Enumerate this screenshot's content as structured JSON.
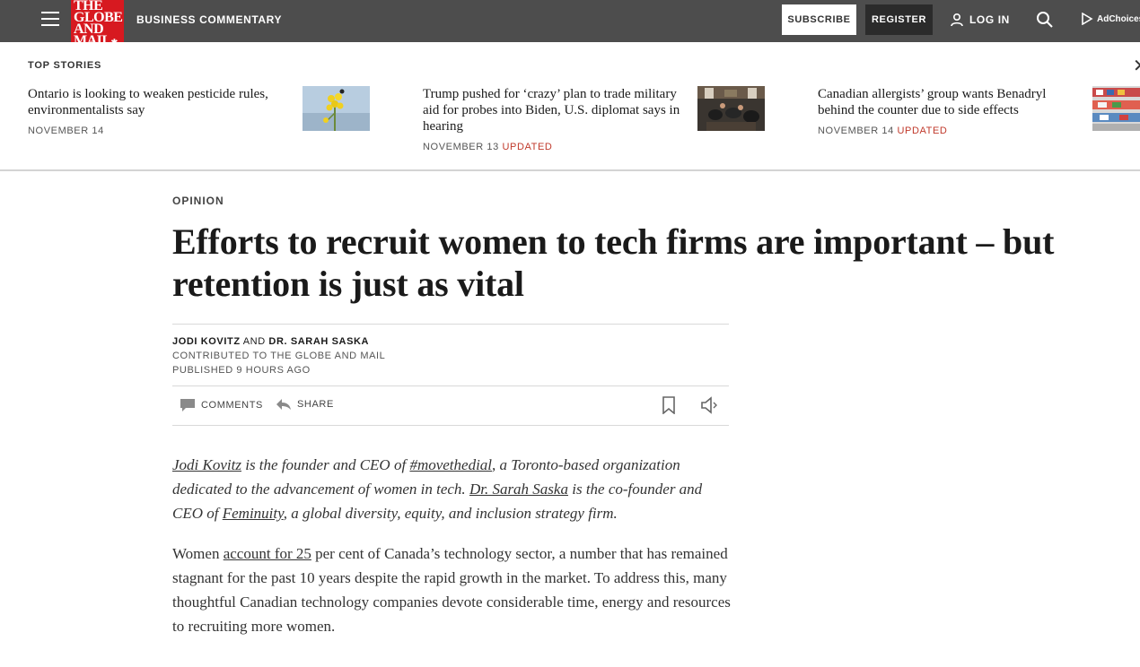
{
  "header": {
    "logo_lines": [
      "THE",
      "GLOBE",
      "AND",
      "MAIL"
    ],
    "section": "Business Commentary",
    "subscribe_label": "Subscribe",
    "register_label": "Register",
    "login_label": "Log In",
    "adchoices_label": "AdChoices"
  },
  "top_stories": {
    "label": "Top Stories",
    "items": [
      {
        "title": "Ontario is looking to weaken pesticide rules, environmentalists say",
        "date": "November 14",
        "updated": ""
      },
      {
        "title": "Trump pushed for ‘crazy’ plan to trade military aid for probes into Biden, U.S. diplomat says in hearing",
        "date": "November 13",
        "updated": "Updated"
      },
      {
        "title": "Canadian allergists’ group wants Benadryl behind the counter due to side effects",
        "date": "November 14",
        "updated": "Updated"
      }
    ]
  },
  "article": {
    "kicker": "Opinion",
    "headline": "Efforts to recruit women to tech firms are important – but retention is just as vital",
    "byline": {
      "author1": "Jodi Kovitz",
      "joiner": "and",
      "author2": "Dr. Sarah Saska",
      "contributed": "Contributed to The Globe and Mail",
      "published": "Published 9 hours ago"
    },
    "tools": {
      "comments_label": "Comments",
      "share_label": "Share"
    },
    "intro": {
      "link1": "Jodi Kovitz",
      "t1": " is the founder and CEO of ",
      "link2": "#movethedial",
      "t2": ", a Toronto-based organization dedicated to the advancement of women in tech. ",
      "link3": "Dr. Sarah Saska",
      "t3": " is the co-founder and CEO of ",
      "link4": "Feminuity",
      "t4": ", a global diversity, equity, and inclusion strategy firm."
    },
    "p1": {
      "t1": "Women ",
      "link1": "account for 25",
      "t2": " per cent of Canada’s technology sector, a number that has remained stagnant for the past 10 years despite the rapid growth in the market. To address this, many thoughtful Canadian technology companies devote considerable time, energy and resources to recruiting more women."
    }
  }
}
